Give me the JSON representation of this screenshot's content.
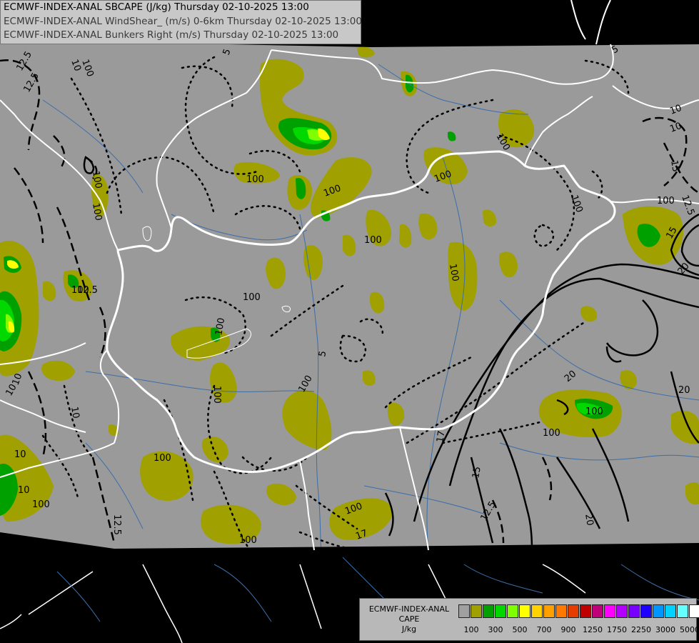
{
  "header": {
    "lines": [
      "ECMWF-INDEX-ANAL SBCAPE (J/kg) Thursday 02-10-2025 13:00",
      "ECMWF-INDEX-ANAL WindShear_ (m/s) 0-6km Thursday 02-10-2025 13:00",
      "ECMWF-INDEX-ANAL Bunkers Right (m/s) Thursday 02-10-2025 13:00"
    ]
  },
  "legend": {
    "model": "ECMWF-INDEX-ANAL",
    "field": "CAPE",
    "unit": "J/kg",
    "colors": [
      "#a0a0a0",
      "#a0a000",
      "#00a000",
      "#00d800",
      "#80ff00",
      "#ffff00",
      "#ffd200",
      "#ffa000",
      "#ff7800",
      "#e63c00",
      "#c00000",
      "#c0007a",
      "#ff00ff",
      "#b400ff",
      "#7800ff",
      "#1e00ff",
      "#0096ff",
      "#00d2ff",
      "#64ffff",
      "#ffffff"
    ],
    "ticks": [
      "100",
      "300",
      "500",
      "700",
      "900",
      "1250",
      "1750",
      "2250",
      "3000",
      "5000"
    ]
  },
  "map": {
    "colors": {
      "background": "#000000",
      "domain": "#9a9a9a",
      "cape_100": "#a0a000",
      "cape_300": "#00a000",
      "cape_500": "#00d800",
      "cape_700": "#80ff00",
      "cape_900": "#ffff00",
      "border": "#ffffff",
      "river": "#3c6ea8",
      "contour": "#000000"
    },
    "contour_labels": [
      "12.5",
      "10",
      "5",
      "5",
      "10",
      "15",
      "12.5",
      "10",
      "100",
      "100",
      "100",
      "100",
      "100",
      "100",
      "100",
      "100",
      "100",
      "100",
      "100",
      "100",
      "100",
      "100",
      "100",
      "100",
      "100",
      "100",
      "10",
      "15",
      "12.5",
      "20",
      "20",
      "20",
      "20",
      "17",
      "15",
      "12.5",
      "20",
      "5",
      "10",
      "10",
      "10",
      "10",
      "12.5",
      "12.5",
      "17",
      "100",
      "100",
      "100",
      "100"
    ]
  }
}
